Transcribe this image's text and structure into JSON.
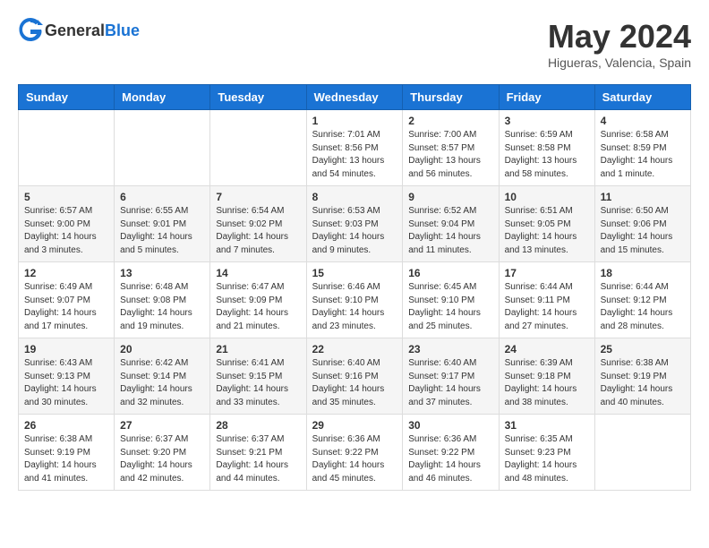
{
  "header": {
    "logo_general": "General",
    "logo_blue": "Blue",
    "month_year": "May 2024",
    "location": "Higueras, Valencia, Spain"
  },
  "days_of_week": [
    "Sunday",
    "Monday",
    "Tuesday",
    "Wednesday",
    "Thursday",
    "Friday",
    "Saturday"
  ],
  "weeks": [
    {
      "row_bg": "#fff",
      "days": [
        {
          "number": "",
          "sunrise": "",
          "sunset": "",
          "daylight": ""
        },
        {
          "number": "",
          "sunrise": "",
          "sunset": "",
          "daylight": ""
        },
        {
          "number": "",
          "sunrise": "",
          "sunset": "",
          "daylight": ""
        },
        {
          "number": "1",
          "sunrise": "7:01 AM",
          "sunset": "8:56 PM",
          "daylight": "13 hours and 54 minutes."
        },
        {
          "number": "2",
          "sunrise": "7:00 AM",
          "sunset": "8:57 PM",
          "daylight": "13 hours and 56 minutes."
        },
        {
          "number": "3",
          "sunrise": "6:59 AM",
          "sunset": "8:58 PM",
          "daylight": "13 hours and 58 minutes."
        },
        {
          "number": "4",
          "sunrise": "6:58 AM",
          "sunset": "8:59 PM",
          "daylight": "14 hours and 1 minute."
        }
      ]
    },
    {
      "row_bg": "#f5f5f5",
      "days": [
        {
          "number": "5",
          "sunrise": "6:57 AM",
          "sunset": "9:00 PM",
          "daylight": "14 hours and 3 minutes."
        },
        {
          "number": "6",
          "sunrise": "6:55 AM",
          "sunset": "9:01 PM",
          "daylight": "14 hours and 5 minutes."
        },
        {
          "number": "7",
          "sunrise": "6:54 AM",
          "sunset": "9:02 PM",
          "daylight": "14 hours and 7 minutes."
        },
        {
          "number": "8",
          "sunrise": "6:53 AM",
          "sunset": "9:03 PM",
          "daylight": "14 hours and 9 minutes."
        },
        {
          "number": "9",
          "sunrise": "6:52 AM",
          "sunset": "9:04 PM",
          "daylight": "14 hours and 11 minutes."
        },
        {
          "number": "10",
          "sunrise": "6:51 AM",
          "sunset": "9:05 PM",
          "daylight": "14 hours and 13 minutes."
        },
        {
          "number": "11",
          "sunrise": "6:50 AM",
          "sunset": "9:06 PM",
          "daylight": "14 hours and 15 minutes."
        }
      ]
    },
    {
      "row_bg": "#fff",
      "days": [
        {
          "number": "12",
          "sunrise": "6:49 AM",
          "sunset": "9:07 PM",
          "daylight": "14 hours and 17 minutes."
        },
        {
          "number": "13",
          "sunrise": "6:48 AM",
          "sunset": "9:08 PM",
          "daylight": "14 hours and 19 minutes."
        },
        {
          "number": "14",
          "sunrise": "6:47 AM",
          "sunset": "9:09 PM",
          "daylight": "14 hours and 21 minutes."
        },
        {
          "number": "15",
          "sunrise": "6:46 AM",
          "sunset": "9:10 PM",
          "daylight": "14 hours and 23 minutes."
        },
        {
          "number": "16",
          "sunrise": "6:45 AM",
          "sunset": "9:10 PM",
          "daylight": "14 hours and 25 minutes."
        },
        {
          "number": "17",
          "sunrise": "6:44 AM",
          "sunset": "9:11 PM",
          "daylight": "14 hours and 27 minutes."
        },
        {
          "number": "18",
          "sunrise": "6:44 AM",
          "sunset": "9:12 PM",
          "daylight": "14 hours and 28 minutes."
        }
      ]
    },
    {
      "row_bg": "#f5f5f5",
      "days": [
        {
          "number": "19",
          "sunrise": "6:43 AM",
          "sunset": "9:13 PM",
          "daylight": "14 hours and 30 minutes."
        },
        {
          "number": "20",
          "sunrise": "6:42 AM",
          "sunset": "9:14 PM",
          "daylight": "14 hours and 32 minutes."
        },
        {
          "number": "21",
          "sunrise": "6:41 AM",
          "sunset": "9:15 PM",
          "daylight": "14 hours and 33 minutes."
        },
        {
          "number": "22",
          "sunrise": "6:40 AM",
          "sunset": "9:16 PM",
          "daylight": "14 hours and 35 minutes."
        },
        {
          "number": "23",
          "sunrise": "6:40 AM",
          "sunset": "9:17 PM",
          "daylight": "14 hours and 37 minutes."
        },
        {
          "number": "24",
          "sunrise": "6:39 AM",
          "sunset": "9:18 PM",
          "daylight": "14 hours and 38 minutes."
        },
        {
          "number": "25",
          "sunrise": "6:38 AM",
          "sunset": "9:19 PM",
          "daylight": "14 hours and 40 minutes."
        }
      ]
    },
    {
      "row_bg": "#fff",
      "days": [
        {
          "number": "26",
          "sunrise": "6:38 AM",
          "sunset": "9:19 PM",
          "daylight": "14 hours and 41 minutes."
        },
        {
          "number": "27",
          "sunrise": "6:37 AM",
          "sunset": "9:20 PM",
          "daylight": "14 hours and 42 minutes."
        },
        {
          "number": "28",
          "sunrise": "6:37 AM",
          "sunset": "9:21 PM",
          "daylight": "14 hours and 44 minutes."
        },
        {
          "number": "29",
          "sunrise": "6:36 AM",
          "sunset": "9:22 PM",
          "daylight": "14 hours and 45 minutes."
        },
        {
          "number": "30",
          "sunrise": "6:36 AM",
          "sunset": "9:22 PM",
          "daylight": "14 hours and 46 minutes."
        },
        {
          "number": "31",
          "sunrise": "6:35 AM",
          "sunset": "9:23 PM",
          "daylight": "14 hours and 48 minutes."
        },
        {
          "number": "",
          "sunrise": "",
          "sunset": "",
          "daylight": ""
        }
      ]
    }
  ]
}
